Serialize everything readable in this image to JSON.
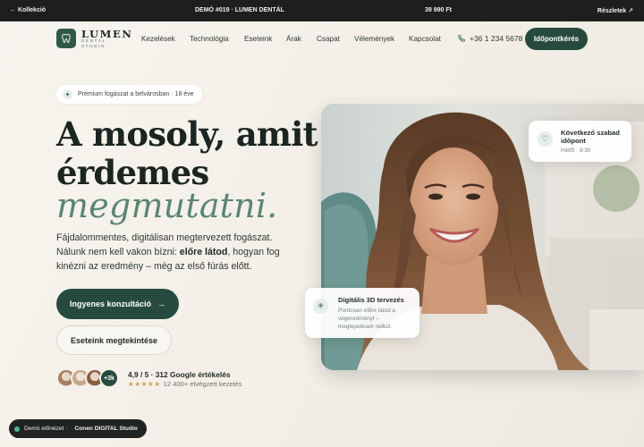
{
  "topbar": {
    "back": "← Kollekció",
    "center": "DEMÓ #019 · LUMEN DENTÁL",
    "price": "39 990 Ft",
    "details": "Részletek ↗"
  },
  "brand": {
    "name": "LUMEN",
    "sub": "DENTÁL STÚDIÓ",
    "accent": "#264b3e",
    "accent_light": "#5b8570"
  },
  "nav": {
    "items": [
      "Kezelések",
      "Technológia",
      "Eseteink",
      "Árak",
      "Csapat",
      "Vélemények",
      "Kapcsolat"
    ],
    "phone": "+36 1 234 5678",
    "cta": "Időpontkérés"
  },
  "hero": {
    "pill": "Prémium fogászat a belvárosban · 18 éve",
    "title_line1": "A mosoly, amit",
    "title_line2": "érdemes",
    "title_line3": "megmutatni.",
    "lead_part1": "Fájdalommentes, digitálisan megtervezett fogászat. Nálunk nem kell vakon bízni: ",
    "lead_bold": "előre látod",
    "lead_part2": ", hogyan fog kinézni az eredmény – még az első fúrás előtt.",
    "cta_primary": "Ingyenes konzultáció",
    "cta_primary_arrow": "→",
    "cta_secondary": "Eseteink megtekintése",
    "avatar_more": "+3k",
    "rating": "4,9 / 5 · 312 Google értékelés",
    "rating_stars": "★★★★★",
    "rating_sub": "12 400+ elvégzett kezelés"
  },
  "cards": {
    "slot_title": "Következő szabad időpont",
    "slot_sub": "Hétfő · 9:30",
    "planning_title": "Digitális 3D tervezés",
    "planning_sub": "Pontosan előre látod a végeredményt – meglepetések nélkül."
  },
  "demo": {
    "label": "Demó előnézet ·",
    "studio": "Conen DIGITAL Studio"
  },
  "icons": [
    "tooth-icon",
    "phone-icon",
    "sparkle-icon",
    "heart-icon",
    "snowflake-icon",
    "arrow-right-icon"
  ]
}
